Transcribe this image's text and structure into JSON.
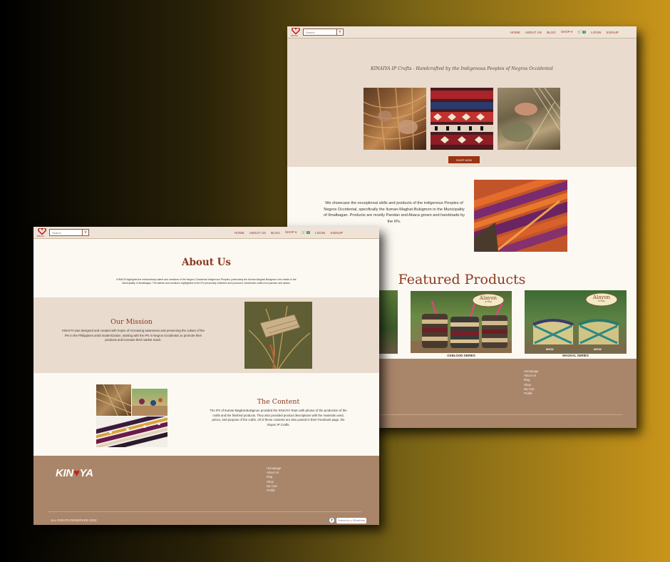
{
  "back_page": {
    "nav": {
      "logo_subtext": "KINAIYA",
      "search_placeholder": "Search",
      "menu": [
        "HOME",
        "ABOUT US",
        "BLOG",
        "SHOP ▾"
      ],
      "cart_count": "0",
      "login": "LOGIN",
      "signup": "SIGNUP"
    },
    "hero": {
      "tagline": "KINAIYA IP Crafts - Handcrafted by the Indigenous Peoples of Negros Occidental",
      "shop_now": "SHOP NOW"
    },
    "intro": {
      "text": "We showcase the exceptional skills and products of the indigenous Peoples of Negros Occidental, specifically the Ituman-Maghat-Bukigmon in the Municipality of Ilmalbagan. Products are mostly Pandan and Abaca grown and handmade by the IPs."
    },
    "featured": {
      "heading": "Featured Products",
      "products": [
        {
          "name": "OXBLOOD SERIES",
          "brand": "Alayon",
          "brand_sub": "IP Crafts"
        },
        {
          "name": "MAGKAL SERIES",
          "brand": "Alayon",
          "brand_sub": "IP Crafts",
          "labels": [
            "MG31",
            "MG32"
          ]
        }
      ]
    },
    "footer_links": [
      "Homepage",
      "About Us",
      "Blog",
      "Shop",
      "My Cart",
      "Profile"
    ]
  },
  "front_page": {
    "nav": {
      "logo_subtext": "KINAIYA",
      "search_placeholder": "Search",
      "menu": [
        "HOME",
        "ABOUT US",
        "BLOG",
        "SHOP ▾"
      ],
      "cart_count": "0",
      "login": "LOGIN",
      "signup": "SIGNUP"
    },
    "about": {
      "heading": "About Us",
      "text": "KINAIYA highlights the extraordinary talent and creations of the Negros Occidental Indigenous Peoples, particularly the Ituman-Maghat-Bukigmon who reside in the Municipality of Ilmalbagan. The talents and creations highlighted in the IPs personally collected and produced, handmade crafts from pandan and abaca."
    },
    "mission": {
      "heading": "Our Mission",
      "text": "KINAIYA was designed and created with hopes of increasing awareness and preserving the culture of the IPs in the Philippines amid modernization, starting with the IPs in Negros Occidental, to promote their products and increase their market reach."
    },
    "content": {
      "heading": "The Content",
      "text": "The IPs of Ituman-Maghat-Bukigmon provided the KINAIYA Team with photos of the production of the crafts and the finished products. They also provided product descriptions with the materials used, prices, and purpose of the crafts. All of these contents are also posted in their Facebook page, the Alayon IP Crafts."
    },
    "footer": {
      "wordmark_left": "KIN",
      "wordmark_right": "YA",
      "links": [
        "Homepage",
        "About Us",
        "Blog",
        "Shop",
        "My Cart",
        "Profile"
      ],
      "copyright": "ALL RIGHTS RESERVED 2022",
      "powered_by": "Powered by",
      "builder": "000webhost"
    }
  },
  "colors": {
    "accent": "#9b3412",
    "nav_bg": "#efe2d6",
    "footer_bg": "#a9856a"
  },
  "icons": {
    "search": "magnifier-icon",
    "cart": "cart-icon",
    "facebook": "facebook-icon"
  }
}
